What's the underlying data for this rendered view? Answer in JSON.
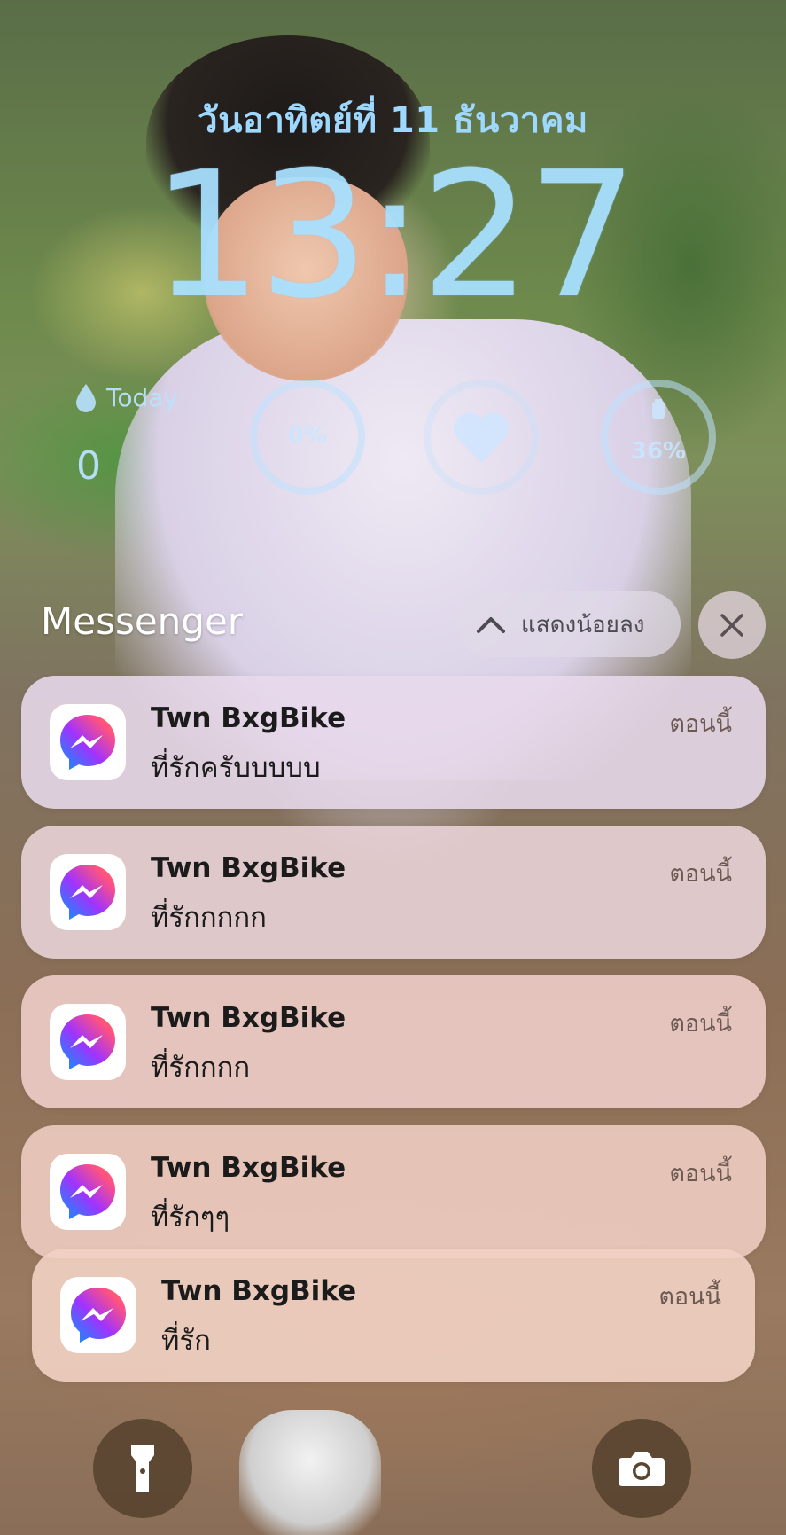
{
  "lockscreen": {
    "date": "วันอาทิตย์ที่ 11 ธันวาคม",
    "time": "13:27"
  },
  "widgets": {
    "water": {
      "label": "Today",
      "value": "0",
      "icon": "water-drop-icon"
    },
    "ring_1": {
      "percent_text": "0%",
      "fraction": 0.0
    },
    "ring_2": {
      "icon": "heart-icon"
    },
    "ring_3": {
      "percent_text": "36%",
      "fraction": 0.36,
      "icon": "battery-icon"
    }
  },
  "notification_group": {
    "app_name": "Messenger",
    "show_less_label": "แสดงน้อยลง",
    "show_less_icon": "chevron-up-icon",
    "close_icon": "close-icon"
  },
  "notifications": [
    {
      "sender": "Twn BxgBike",
      "message": "ที่รักครับบบบบ",
      "time": "ตอนนี้"
    },
    {
      "sender": "Twn BxgBike",
      "message": "ที่รักกกกก",
      "time": "ตอนนี้"
    },
    {
      "sender": "Twn BxgBike",
      "message": "ที่รักกกก",
      "time": "ตอนนี้"
    },
    {
      "sender": "Twn BxgBike",
      "message": "ที่รักๆๆ",
      "time": "ตอนนี้"
    },
    {
      "sender": "Twn BxgBike",
      "message": "ที่รัก",
      "time": "ตอนนี้"
    }
  ],
  "quick_actions": {
    "flashlight_icon": "flashlight-icon",
    "camera_icon": "camera-icon"
  },
  "colors": {
    "clock": "#aae1ff",
    "notification_bg": "#ecd6dc",
    "messenger_gradient": [
      "#0099ff",
      "#a033ff",
      "#ff5280",
      "#ff7061"
    ]
  }
}
